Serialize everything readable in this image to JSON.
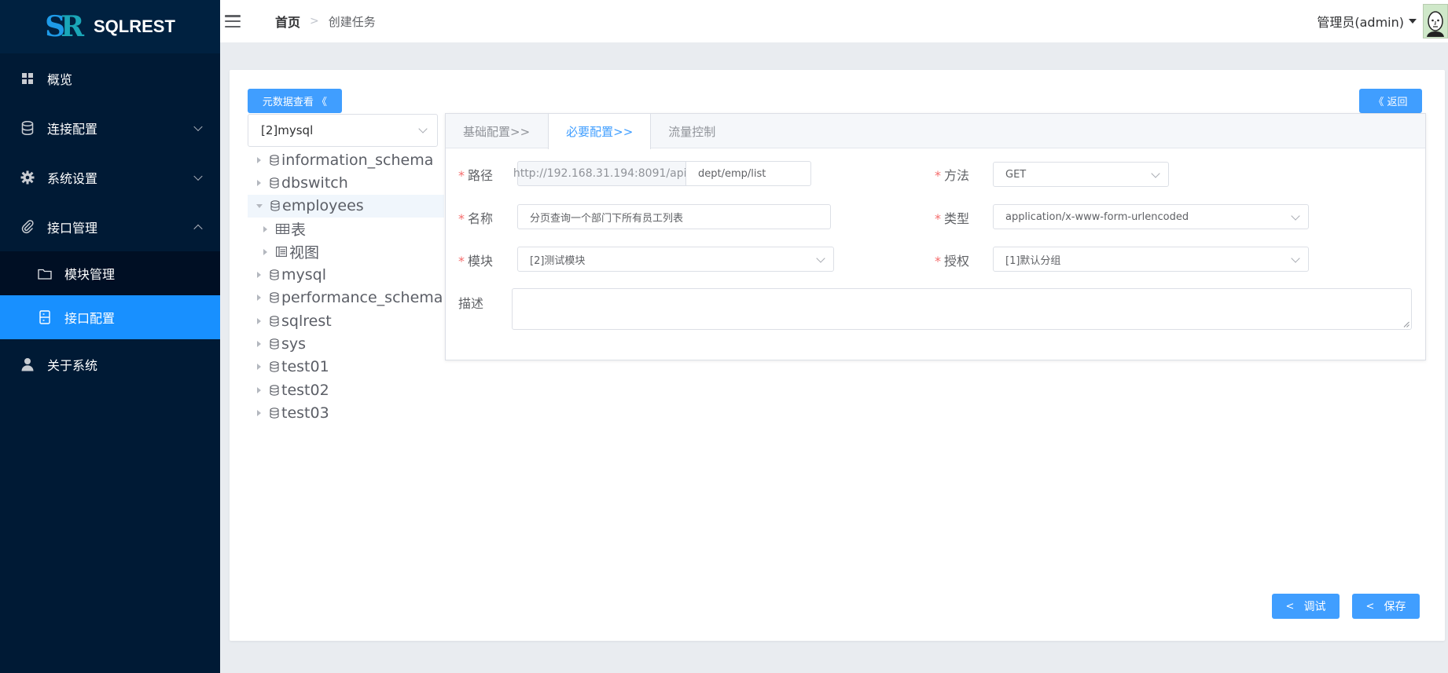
{
  "app": {
    "logo_text": "SQLREST",
    "logo_mark": {
      "s": "S",
      "r": "R"
    }
  },
  "sidebar": {
    "items": [
      {
        "label": "概览",
        "icon": "grid-icon"
      },
      {
        "label": "连接配置",
        "icon": "database-icon"
      },
      {
        "label": "系统设置",
        "icon": "gear-icon"
      },
      {
        "label": "接口管理",
        "icon": "paperclip-icon"
      },
      {
        "label": "模块管理",
        "icon": "folder-icon"
      },
      {
        "label": "接口配置",
        "icon": "document-icon"
      },
      {
        "label": "关于系统",
        "icon": "user-icon"
      }
    ]
  },
  "header": {
    "breadcrumb_home": "首页",
    "breadcrumb_current": "创建任务",
    "user_name": "管理员(admin)"
  },
  "toolbar": {
    "meta_label": "元数据查看 《",
    "back_label": "《 返回"
  },
  "tree": {
    "selected_source": "[2]mysql",
    "nodes": [
      "information_schema",
      "dbswitch",
      "employees",
      "表",
      "视图",
      "mysql",
      "performance_schema",
      "sqlrest",
      "sys",
      "test01",
      "test02",
      "test03"
    ]
  },
  "tabs": [
    "基础配置>>",
    "必要配置>>",
    "流量控制"
  ],
  "form": {
    "path_label": "路径",
    "path_prefix": "http://192.168.31.194:8091/api/",
    "path_value": "dept/emp/list",
    "method_label": "方法",
    "method_value": "GET",
    "name_label": "名称",
    "name_value": "分页查询一个部门下所有员工列表",
    "type_label": "类型",
    "type_value": "application/x-www-form-urlencoded",
    "module_label": "模块",
    "module_value": "[2]测试模块",
    "auth_label": "授权",
    "auth_value": "[1]默认分组",
    "desc_label": "描述",
    "desc_value": ""
  },
  "actions": {
    "debug_label": "调试",
    "save_label": "保存"
  },
  "colors": {
    "sidebar_bg": "#001a35",
    "active_blue": "#1890ff",
    "primary": "#409eff",
    "required": "#f56c6c"
  }
}
